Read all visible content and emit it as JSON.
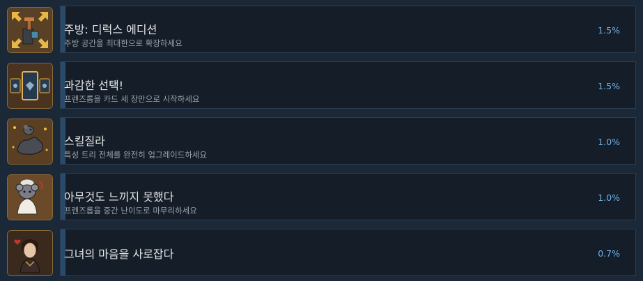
{
  "achievements": [
    {
      "title": "주방: 디럭스 에디션",
      "description": "주방 공간을 최대한으로 확장하세요",
      "percent": "1.5%",
      "icon": "expand-arrows-kitchen-icon",
      "progress": 0.015
    },
    {
      "title": "과감한 선택!",
      "description": "프렌즈롭을 카드 세 장만으로 시작하세요",
      "percent": "1.5%",
      "icon": "three-cards-icon",
      "progress": 0.015
    },
    {
      "title": "스킬질라",
      "description": "특성 트리 전체를 완전히 업그레이드하세요",
      "percent": "1.0%",
      "icon": "muscle-arm-rat-icon",
      "progress": 0.01
    },
    {
      "title": "아무것도 느끼지 못했다",
      "description": "프렌즈롭을 중간 난이도로 마무리하세요",
      "percent": "1.0%",
      "icon": "chef-rat-icon",
      "progress": 0.01
    },
    {
      "title": "그녀의 마음을 사로잡다",
      "description": "",
      "percent": "0.7%",
      "icon": "portrait-heart-icon",
      "progress": 0.007
    }
  ],
  "colors": {
    "background": "#1b2838",
    "panel": "#141d28",
    "panel_border": "#2c3d52",
    "percent_text": "#6fb2e8",
    "title_text": "#e6e6e6",
    "desc_text": "#9aa3ab",
    "icon_frame_border": "#8a6a3a"
  }
}
